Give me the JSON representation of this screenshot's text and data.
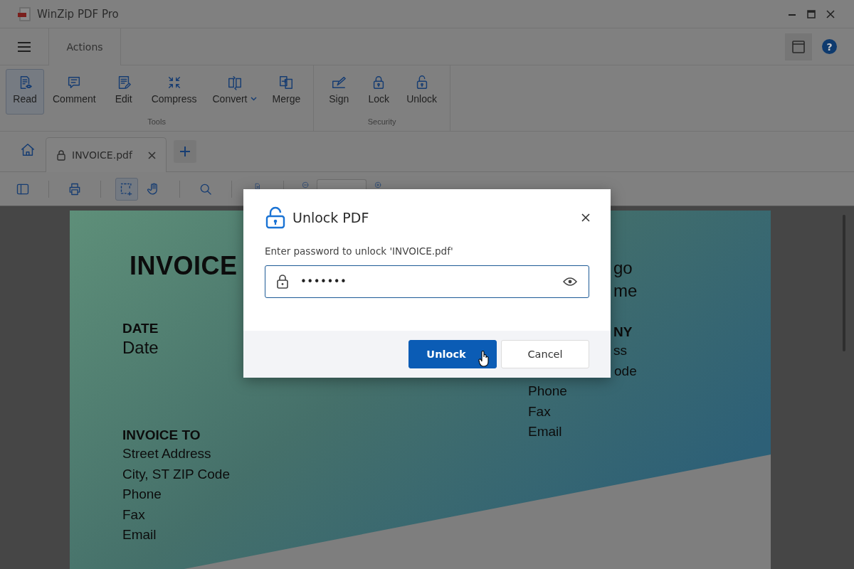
{
  "window": {
    "title": "WinZip PDF Pro"
  },
  "help_button": "?",
  "ribbon_tabs": [
    {
      "label": "Actions",
      "selected": true
    }
  ],
  "ribbon_groups": [
    {
      "label": "Tools",
      "buttons": [
        {
          "label": "Read",
          "selected": true
        },
        {
          "label": "Comment",
          "selected": false
        },
        {
          "label": "Edit",
          "selected": false
        },
        {
          "label": "Compress",
          "selected": false
        },
        {
          "label": "Convert",
          "selected": false,
          "dropdown": true
        },
        {
          "label": "Merge",
          "selected": false
        }
      ]
    },
    {
      "label": "Security",
      "buttons": [
        {
          "label": "Sign",
          "selected": false
        },
        {
          "label": "Lock",
          "selected": false
        },
        {
          "label": "Unlock",
          "selected": false
        }
      ]
    }
  ],
  "file_tabs": [
    {
      "label": "INVOICE.pdf",
      "locked": true,
      "selected": true
    }
  ],
  "toolbar": [
    {
      "selected": false
    },
    {
      "selected": false
    },
    {
      "selected": true
    },
    {
      "selected": false
    },
    {
      "selected": false
    },
    {
      "selected": false
    }
  ],
  "document": {
    "title": "INVOICE",
    "left": [
      {
        "kind": "heading",
        "text": "DATE"
      },
      {
        "kind": "value",
        "text": "Date"
      },
      {
        "kind": "heading",
        "text": "INVOICE TO"
      },
      {
        "kind": "line",
        "text": "Street Address"
      },
      {
        "kind": "line",
        "text": "City, ST ZIP Code"
      },
      {
        "kind": "line",
        "text": "Phone"
      },
      {
        "kind": "line",
        "text": "Fax"
      },
      {
        "kind": "line",
        "text": "Email"
      }
    ],
    "right": [
      {
        "kind": "big",
        "text": "go"
      },
      {
        "kind": "big",
        "text": "me"
      },
      {
        "kind": "heading",
        "text": "NY"
      },
      {
        "kind": "line",
        "text": "ss"
      },
      {
        "kind": "line",
        "text": "ode"
      },
      {
        "kind": "line",
        "text": "Phone"
      },
      {
        "kind": "line",
        "text": "Fax"
      },
      {
        "kind": "line",
        "text": "Email"
      }
    ]
  },
  "dialog": {
    "title": "Unlock PDF",
    "prompt": "Enter password to unlock 'INVOICE.pdf'",
    "password": "•••••••",
    "buttons": [
      {
        "label": "Unlock",
        "kind": "primary"
      },
      {
        "label": "Cancel",
        "kind": "secondary"
      }
    ]
  }
}
